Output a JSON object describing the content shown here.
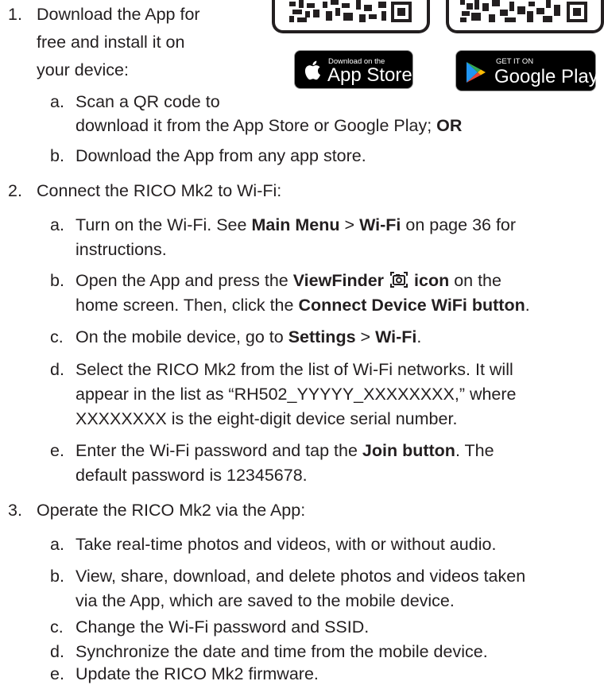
{
  "steps": [
    {
      "num": "1.",
      "lines": [
        "Download the App for",
        "free and install it on",
        "your device:"
      ],
      "subs": [
        {
          "letter": "a.",
          "line1": "Scan a QR code to",
          "line2_plain": "download it from the App Store or Google Play; ",
          "line2_bold": "OR"
        },
        {
          "letter": "b.",
          "text": "Download the App from any app store."
        }
      ]
    },
    {
      "num": "2.",
      "text": "Connect the RICO Mk2 to Wi-Fi:",
      "subs": [
        {
          "letter": "a.",
          "p1": "Turn on the Wi-Fi. See ",
          "b1": "Main Menu",
          "p2": " > ",
          "b2": "Wi-Fi",
          "p3": " on page 36 for",
          "line2": "instructions."
        },
        {
          "letter": "b.",
          "p1": "Open the App and press the ",
          "b1": "ViewFinder",
          "b2": "icon",
          "p2": " on the",
          "line2_plain": "home screen. Then, click the ",
          "line2_bold": "Connect Device WiFi button",
          "line2_end": "."
        },
        {
          "letter": "c.",
          "p1": "On the mobile device, go to ",
          "b1": "Settings",
          "p2": " > ",
          "b2": "Wi-Fi",
          "p3": "."
        },
        {
          "letter": "d.",
          "lines": [
            "Select the RICO Mk2 from the list of Wi-Fi networks. It will",
            "appear in the list as “RH502_YYYYY_XXXXXXXX,” where",
            "XXXXXXXX is the eight-digit device serial number."
          ]
        },
        {
          "letter": "e.",
          "p1": "Enter the Wi-Fi password and tap the ",
          "b1": "Join button",
          "p2": ". The",
          "line2": "default password is 12345678."
        }
      ]
    },
    {
      "num": "3.",
      "text": "Operate the RICO Mk2 via the App:",
      "subs": [
        {
          "letter": "a.",
          "text": "Take real-time photos and videos, with or without audio."
        },
        {
          "letter": "b.",
          "lines": [
            "View, share, download, and delete photos and videos taken",
            "via the App, which are saved to the mobile device."
          ]
        },
        {
          "letter": "c.",
          "text": "Change the Wi-Fi password and SSID."
        },
        {
          "letter": "d.",
          "text": "Synchronize the date and time from the mobile device."
        },
        {
          "letter": "e.",
          "text": "Update the RICO Mk2 firmware."
        }
      ]
    }
  ],
  "badges": {
    "app_store": {
      "small": "Download on the",
      "big": "App Store",
      "icon": "apple-logo-icon"
    },
    "google_play": {
      "small": "GET IT ON",
      "big": "Google Play",
      "icon": "google-play-logo-icon"
    }
  },
  "qr_codes": [
    {
      "name": "app-store-qr-code",
      "icon": "qr-code-icon"
    },
    {
      "name": "google-play-qr-code",
      "icon": "qr-code-icon"
    }
  ],
  "colors": {
    "text": "#231f20",
    "badge_bg": "#000000",
    "badge_border": "#9c9c9c"
  }
}
